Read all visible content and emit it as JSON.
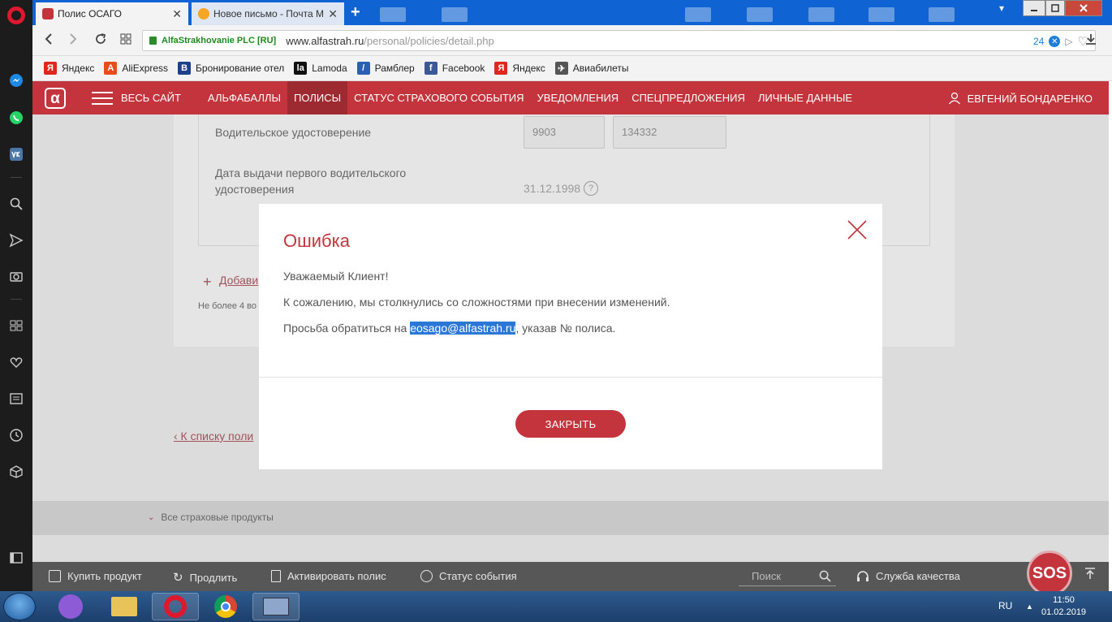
{
  "browser": {
    "tabs": [
      {
        "title": "Полис ОСАГО",
        "close": "✕"
      },
      {
        "title": "Новое письмо - Почта М",
        "close": "✕"
      }
    ],
    "new_tab": "+",
    "address": {
      "secure_label": "AlfaStrakhovanie PLC [RU]",
      "host": "www.alfastrah.ru",
      "path": "/personal/policies/detail.php",
      "badge_count": "24"
    },
    "bookmarks": [
      {
        "label": "Яндекс",
        "icon": "yandex-icon",
        "color": "#e0271f",
        "glyph": "Я"
      },
      {
        "label": "AliExpress",
        "icon": "aliexpress-icon",
        "color": "#e84c1a",
        "glyph": "A"
      },
      {
        "label": "Бронирование отел",
        "icon": "booking-icon",
        "color": "#1f3e8c",
        "glyph": "B"
      },
      {
        "label": "Lamoda",
        "icon": "lamoda-icon",
        "color": "#111111",
        "glyph": "la"
      },
      {
        "label": "Рамблер",
        "icon": "rambler-icon",
        "color": "#2b5fb4",
        "glyph": "/"
      },
      {
        "label": "Facebook",
        "icon": "facebook-icon",
        "color": "#3b5998",
        "glyph": "f"
      },
      {
        "label": "Яндекс",
        "icon": "yandex-icon",
        "color": "#e0271f",
        "glyph": "Я"
      },
      {
        "label": "Авиабилеты",
        "icon": "plane-icon",
        "color": "#555555",
        "glyph": "✈"
      }
    ]
  },
  "site_nav": {
    "logo": "α",
    "all_site": "ВЕСЬ САЙТ",
    "items": [
      {
        "label": "АЛЬФАБАЛЛЫ",
        "active": false
      },
      {
        "label": "ПОЛИСЫ",
        "active": true
      },
      {
        "label": "СТАТУС СТРАХОВОГО СОБЫТИЯ",
        "active": false
      },
      {
        "label": "УВЕДОМЛЕНИЯ",
        "active": false
      },
      {
        "label": "СПЕЦПРЕДЛОЖЕНИЯ",
        "active": false
      },
      {
        "label": "ЛИЧНЫЕ ДАННЫЕ",
        "active": false
      }
    ],
    "user": "ЕВГЕНИЙ БОНДАРЕНКО"
  },
  "page": {
    "license_label": "Водительское удостоверение",
    "license_series": "9903",
    "license_number": "134332",
    "first_issue_label_1": "Дата выдачи первого водительского",
    "first_issue_label_2": "удостоверения",
    "first_issue_date": "31.12.1998",
    "help_glyph": "?",
    "add_plus": "+",
    "add_link": "Добави",
    "add_note": "Не более 4 во",
    "back_link": "‹ К списку поли",
    "footer_link": "Все страховые продукты"
  },
  "modal": {
    "title": "Ошибка",
    "line1": "Уважаемый Клиент!",
    "line2": "К сожалению, мы столкнулись со сложностями при внесении изменений.",
    "line3_prefix": "Просьба обратиться на ",
    "email": "eosago@alfastrah.ru",
    "line3_suffix": ", указав № полиса.",
    "button": "ЗАКРЫТЬ"
  },
  "bottom_bar": {
    "buy": "Купить продукт",
    "renew": "Продлить",
    "activate": "Активировать полис",
    "status": "Статус события",
    "search_placeholder": "Поиск",
    "quality": "Служба качества",
    "sos": "SOS"
  },
  "taskbar": {
    "lang": "RU",
    "time": "11:50",
    "date": "01.02.2019"
  },
  "colors": {
    "brand_red": "#c3343c",
    "tab_bar_blue": "#0f63d2",
    "email_highlight": "#2b77d8"
  }
}
